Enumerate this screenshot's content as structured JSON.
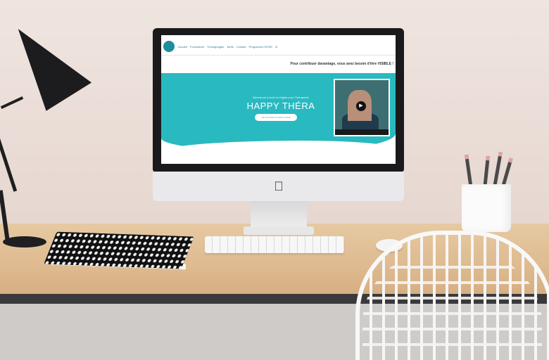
{
  "website": {
    "nav_items": [
      "Accueil",
      "Formations",
      "Témoignages",
      "Tarifs",
      "Contact",
      "Programme ROSE",
      "☑"
    ],
    "tagline": "Pour contribuer davantage, vous avez besoin d'être VISIBLE !",
    "hero_subtitle": "Bienvenue à bord ou Digital pour Thérapeute",
    "hero_title": "HAPPY THÉRA",
    "hero_button": "DÉCOUVREZ NOTRE OFFRE"
  },
  "colors": {
    "accent": "#29b9c0",
    "wall": "#ece1dc",
    "desk": "#deba8f"
  },
  "icons": {
    "apple": "apple-logo-icon",
    "play": "play-icon"
  }
}
